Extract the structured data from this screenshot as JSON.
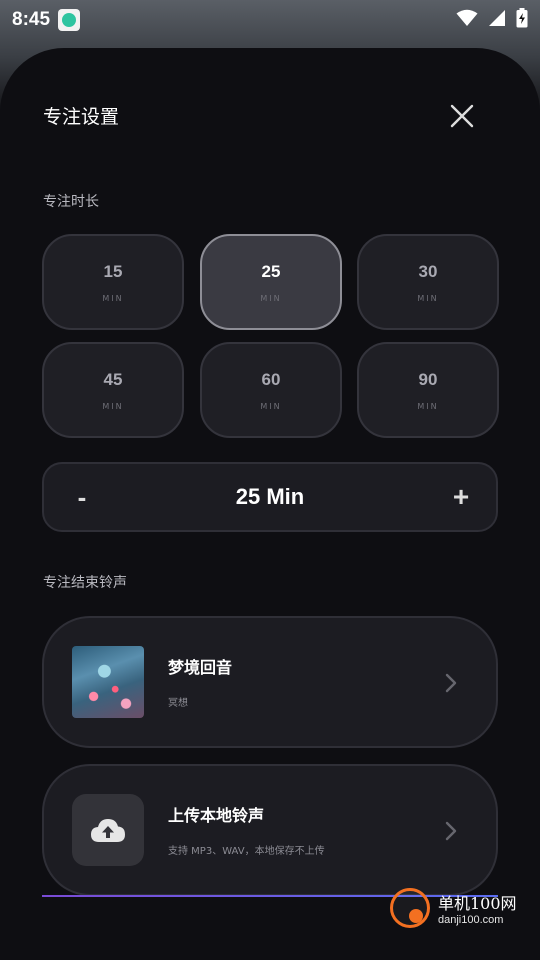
{
  "status_bar": {
    "time": "8:45",
    "icons": [
      "app-notification-icon",
      "wifi-icon",
      "signal-icon",
      "battery-charging-icon"
    ]
  },
  "sheet": {
    "title": "专注设置",
    "close_icon": "close-icon"
  },
  "duration": {
    "section_label": "专注时长",
    "options": [
      {
        "value": "15",
        "unit": "MIN",
        "selected": false
      },
      {
        "value": "25",
        "unit": "MIN",
        "selected": true
      },
      {
        "value": "30",
        "unit": "MIN",
        "selected": false
      },
      {
        "value": "45",
        "unit": "MIN",
        "selected": false
      },
      {
        "value": "60",
        "unit": "MIN",
        "selected": false
      },
      {
        "value": "90",
        "unit": "MIN",
        "selected": false
      }
    ],
    "stepper": {
      "minus_label": "-",
      "value_label": "25 Min",
      "plus_label": "+"
    }
  },
  "sound": {
    "section_label": "专注结束铃声",
    "current": {
      "title": "梦境回音",
      "subtitle": "冥想"
    },
    "upload": {
      "title": "上传本地铃声",
      "subtitle": "支持 MP3、WAV，本地保存不上传",
      "icon": "cloud-upload-icon"
    }
  },
  "watermark": {
    "name": "单机100网",
    "url": "danji100.com"
  },
  "colors": {
    "background": "#0e0e12",
    "card": "#1c1c22",
    "selected": "#3a3a42",
    "accent_line": "#7a4bd6",
    "watermark_orange": "#f37021"
  }
}
